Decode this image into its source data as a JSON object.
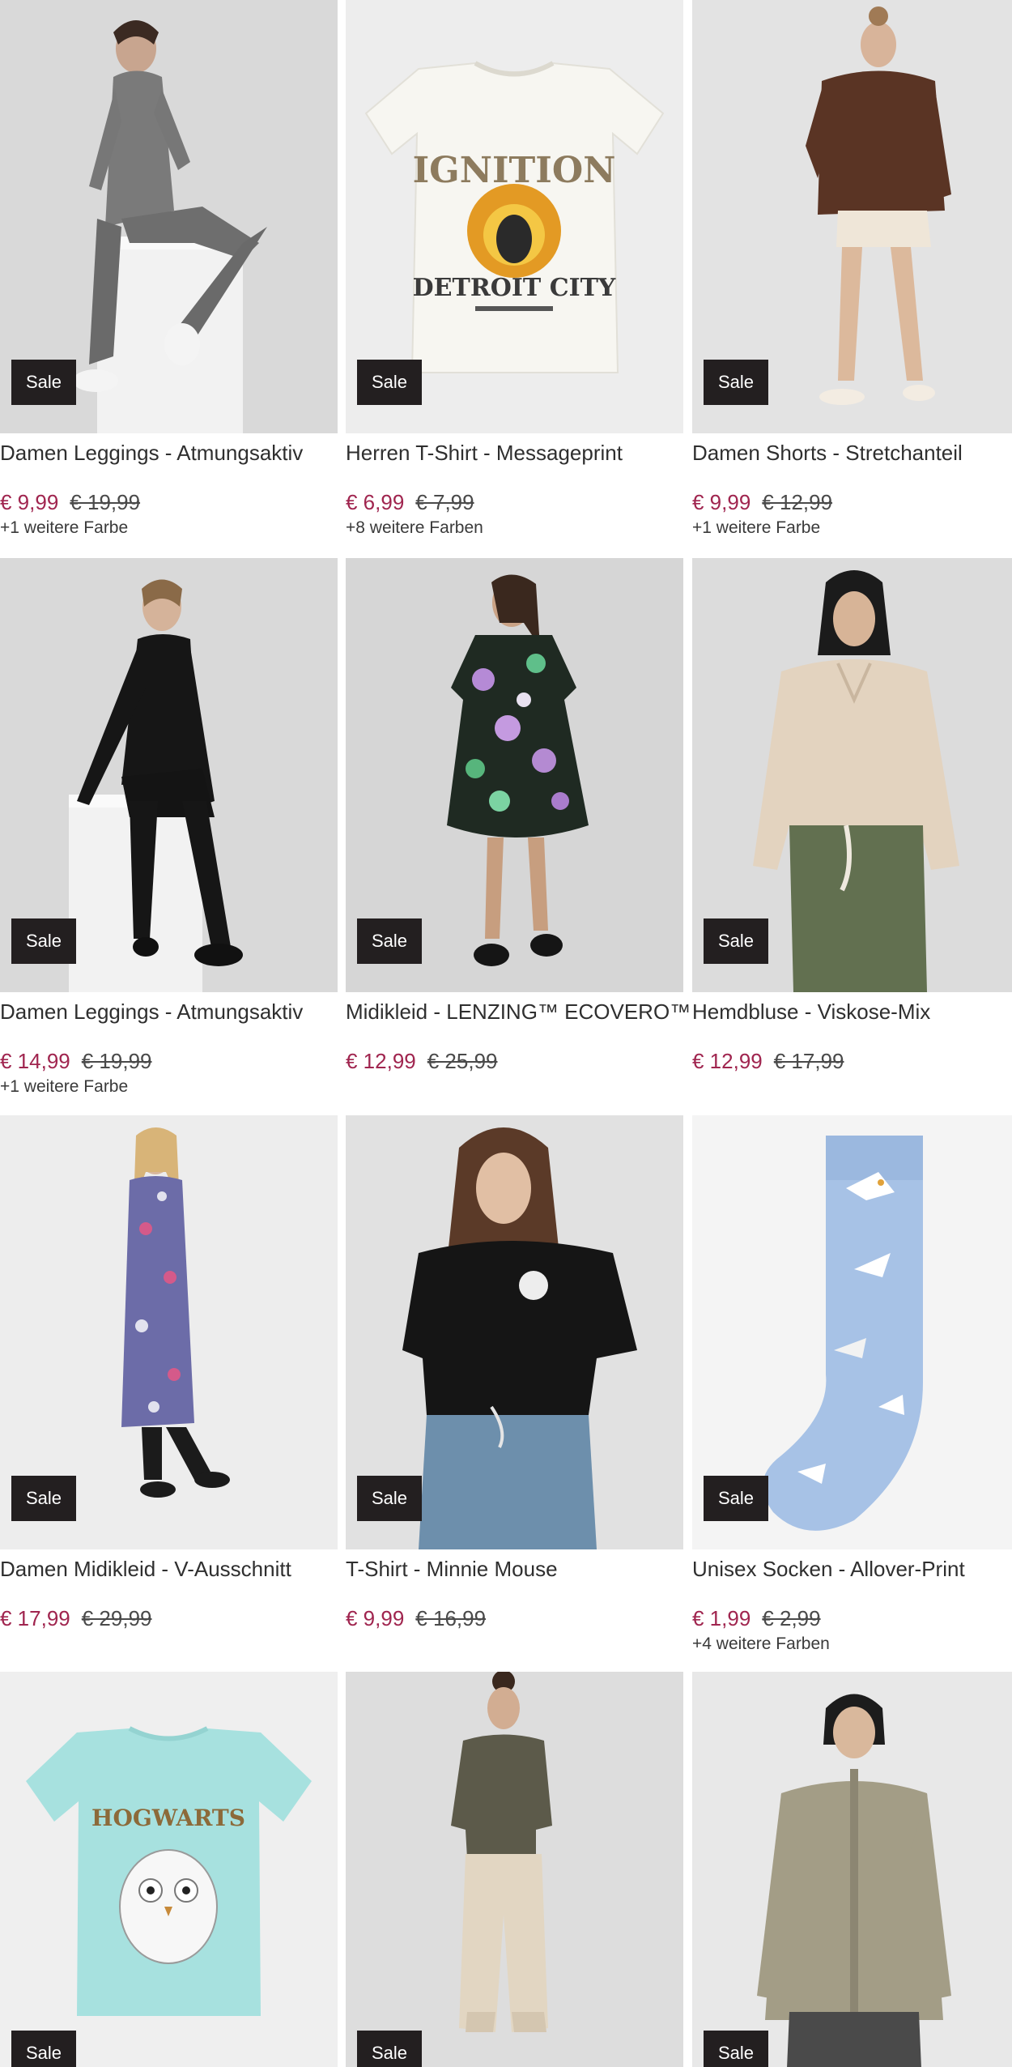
{
  "products": [
    {
      "title": "Damen Leggings - Atmungsaktiv",
      "badge": "Sale",
      "price_now": "€ 9,99",
      "price_old": "€ 19,99",
      "colors": "+1 weitere Farbe"
    },
    {
      "title": "Herren T-Shirt - Messageprint",
      "badge": "Sale",
      "price_now": "€ 6,99",
      "price_old": "€ 7,99",
      "colors": "+8 weitere Farben"
    },
    {
      "title": "Damen Shorts - Stretchanteil",
      "badge": "Sale",
      "price_now": "€ 9,99",
      "price_old": "€ 12,99",
      "colors": "+1 weitere Farbe"
    },
    {
      "title": "Damen Leggings - Atmungsaktiv",
      "badge": "Sale",
      "price_now": "€ 14,99",
      "price_old": "€ 19,99",
      "colors": "+1 weitere Farbe"
    },
    {
      "title": "Midikleid - LENZING™ ECOVERO™",
      "badge": "Sale",
      "price_now": "€ 12,99",
      "price_old": "€ 25,99",
      "colors": ""
    },
    {
      "title": "Hemdbluse - Viskose-Mix",
      "badge": "Sale",
      "price_now": "€ 12,99",
      "price_old": "€ 17,99",
      "colors": ""
    },
    {
      "title": "Damen Midikleid - V-Ausschnitt",
      "badge": "Sale",
      "price_now": "€ 17,99",
      "price_old": "€ 29,99",
      "colors": ""
    },
    {
      "title": "T-Shirt - Minnie Mouse",
      "badge": "Sale",
      "price_now": "€ 9,99",
      "price_old": "€ 16,99",
      "colors": ""
    },
    {
      "title": "Unisex Socken - Allover-Print",
      "badge": "Sale",
      "price_now": "€ 1,99",
      "price_old": "€ 2,99",
      "colors": "+4 weitere Farben"
    },
    {
      "title": "",
      "badge": "Sale",
      "price_now": "",
      "price_old": "",
      "colors": ""
    },
    {
      "title": "",
      "badge": "Sale",
      "price_now": "",
      "price_old": "",
      "colors": ""
    },
    {
      "title": "",
      "badge": "Sale",
      "price_now": "",
      "price_old": "",
      "colors": ""
    }
  ],
  "print_text": {
    "ignition": "IGNITION",
    "detroit": "DETROIT CITY",
    "hogwarts": "HOGWARTS"
  },
  "colors": {
    "sale_bg": "#231f20",
    "price_now": "#a0254f",
    "tile_bg": "#e6e6e6"
  }
}
